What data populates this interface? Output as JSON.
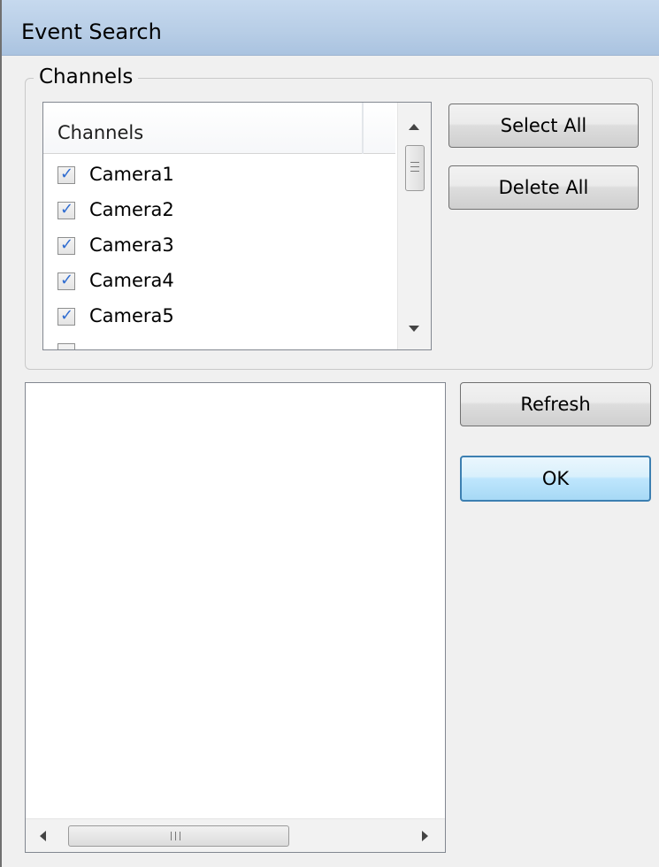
{
  "window": {
    "title": "Event Search"
  },
  "channels_group": {
    "label": "Channels",
    "list_header": "Channels",
    "items": [
      {
        "label": "Camera1",
        "checked": true
      },
      {
        "label": "Camera2",
        "checked": true
      },
      {
        "label": "Camera3",
        "checked": true
      },
      {
        "label": "Camera4",
        "checked": true
      },
      {
        "label": "Camera5",
        "checked": true
      }
    ],
    "select_all_label": "Select All",
    "delete_all_label": "Delete All"
  },
  "actions": {
    "refresh_label": "Refresh",
    "ok_label": "OK"
  },
  "icons": {
    "checkbox_check": "check-icon",
    "scroll_up": "scroll-up-arrow-icon",
    "scroll_down": "scroll-down-arrow-icon",
    "scroll_left": "scroll-left-arrow-icon",
    "scroll_right": "scroll-right-arrow-icon"
  },
  "colors": {
    "titlebar": "#b7cde6",
    "checkmark": "#2f6cd0",
    "default_button_border": "#3c7fb1",
    "dialog_background": "#f0f0f0"
  }
}
